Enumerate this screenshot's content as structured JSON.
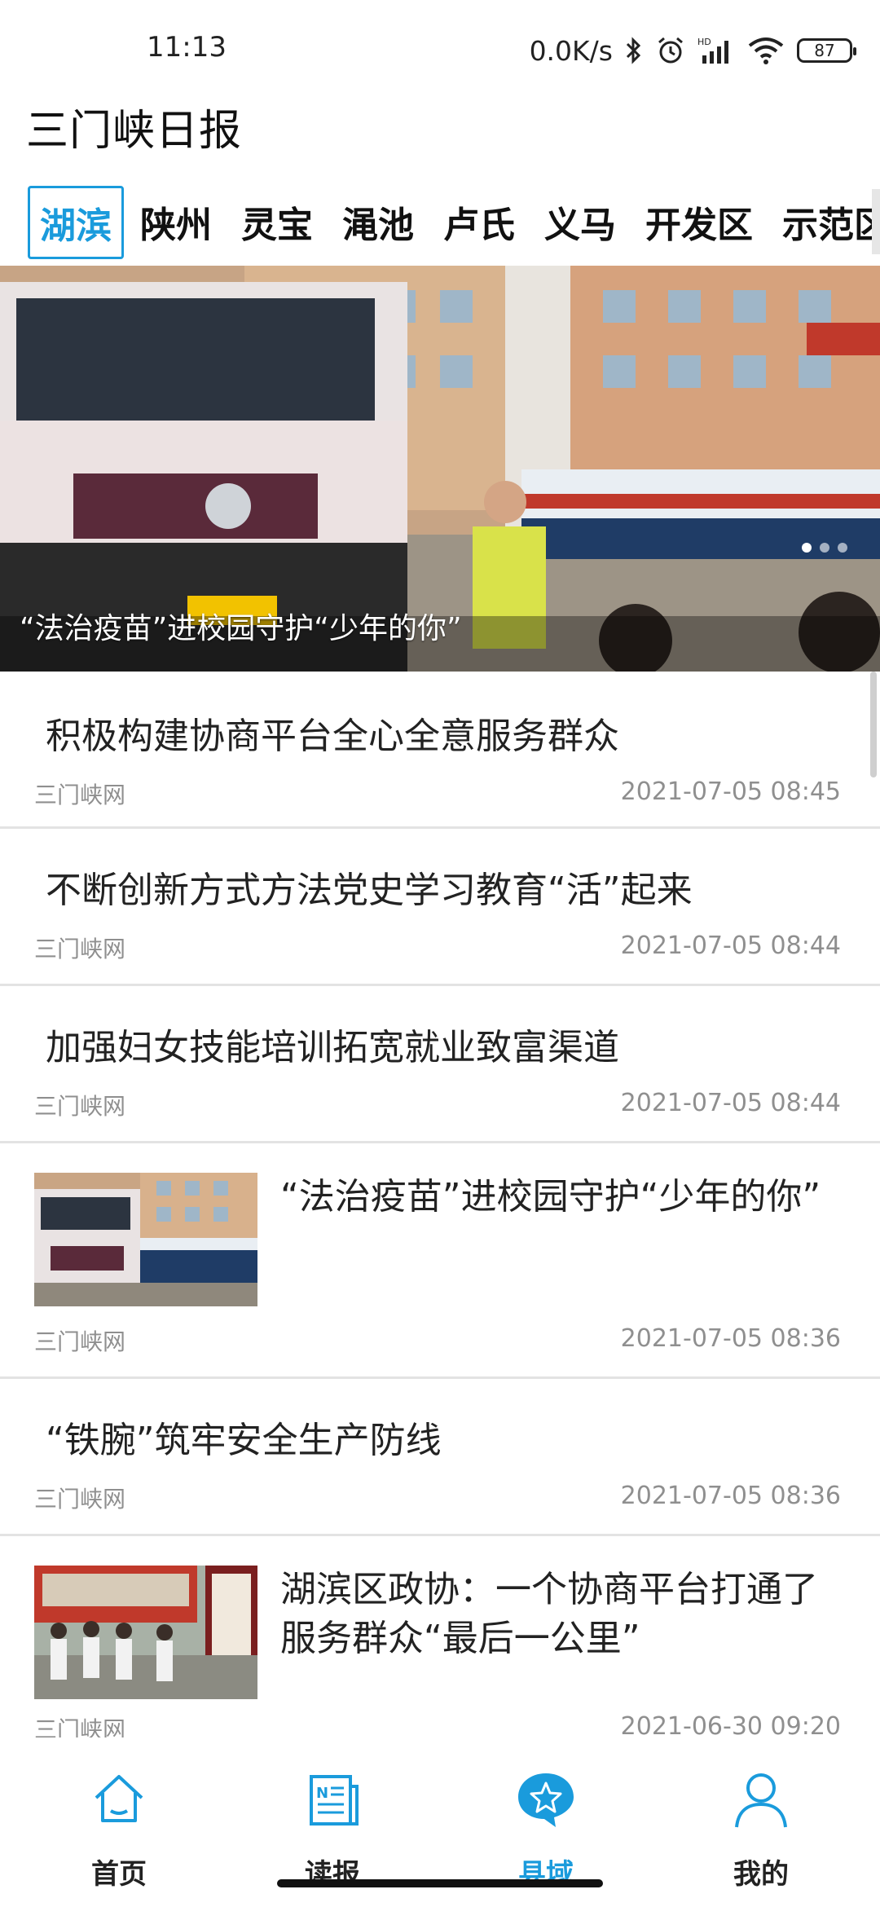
{
  "status_bar": {
    "time": "11:13",
    "net_speed": "0.0K/s",
    "battery": "87",
    "icons": [
      "bluetooth-icon",
      "alarm-icon",
      "hd-signal-icon",
      "wifi-icon",
      "battery-icon"
    ]
  },
  "app": {
    "title": "三门峡日报"
  },
  "tabs": [
    "湖滨",
    "陕州",
    "灵宝",
    "渑池",
    "卢氏",
    "义马",
    "开发区",
    "示范区"
  ],
  "active_tab_index": 0,
  "colors": {
    "accent": "#1a9bdc",
    "text": "#222222",
    "muted": "#8f8f8f",
    "divider": "#e3e3e3"
  },
  "hero": {
    "caption": "“法治疫苗”进校园守护“少年的你”",
    "dot_count": 3,
    "active_dot": 0
  },
  "news": [
    {
      "title": "积极构建协商平台全心全意服务群众",
      "source": "三门峡网",
      "time": "2021-07-05 08:45"
    },
    {
      "title": "不断创新方式方法党史学习教育“活”起来",
      "source": "三门峡网",
      "time": "2021-07-05 08:44"
    },
    {
      "title": "加强妇女技能培训拓宽就业致富渠道",
      "source": "三门峡网",
      "time": "2021-07-05 08:44"
    },
    {
      "title": "“法治疫苗”进校园守护“少年的你”",
      "source": "三门峡网",
      "time": "2021-07-05 08:36",
      "thumbnail": "truck-school-photo"
    },
    {
      "title": "“铁腕”筑牢安全生产防线",
      "source": "三门峡网",
      "time": "2021-07-05 08:36"
    },
    {
      "title": "湖滨区政协：一个协商平台打通了服务群众“最后一公里”",
      "source": "三门峡网",
      "time": "2021-06-30 09:20",
      "thumbnail": "street-meeting-photo"
    }
  ],
  "bottom_nav": [
    {
      "label": "首页",
      "icon": "home-icon"
    },
    {
      "label": "读报",
      "icon": "newspaper-icon"
    },
    {
      "label": "县域",
      "icon": "star-bubble-icon",
      "active": true
    },
    {
      "label": "我的",
      "icon": "person-icon"
    }
  ]
}
